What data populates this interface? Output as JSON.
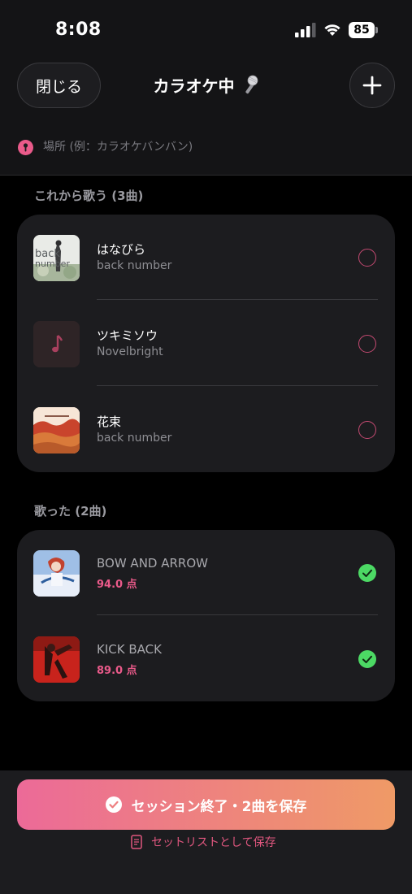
{
  "status_bar": {
    "time": "8:08",
    "battery": "85"
  },
  "header": {
    "close_label": "閉じる",
    "title": "カラオケ中",
    "location_placeholder": "場所 (例：カラオケバンバン)"
  },
  "upcoming": {
    "heading": "これから歌う (3曲)",
    "items": [
      {
        "title": "はなびら",
        "artist": "back number"
      },
      {
        "title": "ツキミソウ",
        "artist": "Novelbright"
      },
      {
        "title": "花束",
        "artist": "back number"
      }
    ]
  },
  "sung": {
    "heading": "歌った (2曲)",
    "items": [
      {
        "title": "BOW AND ARROW",
        "score": "94.0 点"
      },
      {
        "title": "KICK BACK",
        "score": "89.0 点"
      }
    ]
  },
  "footer": {
    "save_button": "セッション終了・2曲を保存",
    "setlist_link": "セットリストとして保存"
  },
  "colors": {
    "accent_pink": "#ea5a8a",
    "accent_orange": "#ef9a66",
    "check_green": "#4cd964"
  }
}
